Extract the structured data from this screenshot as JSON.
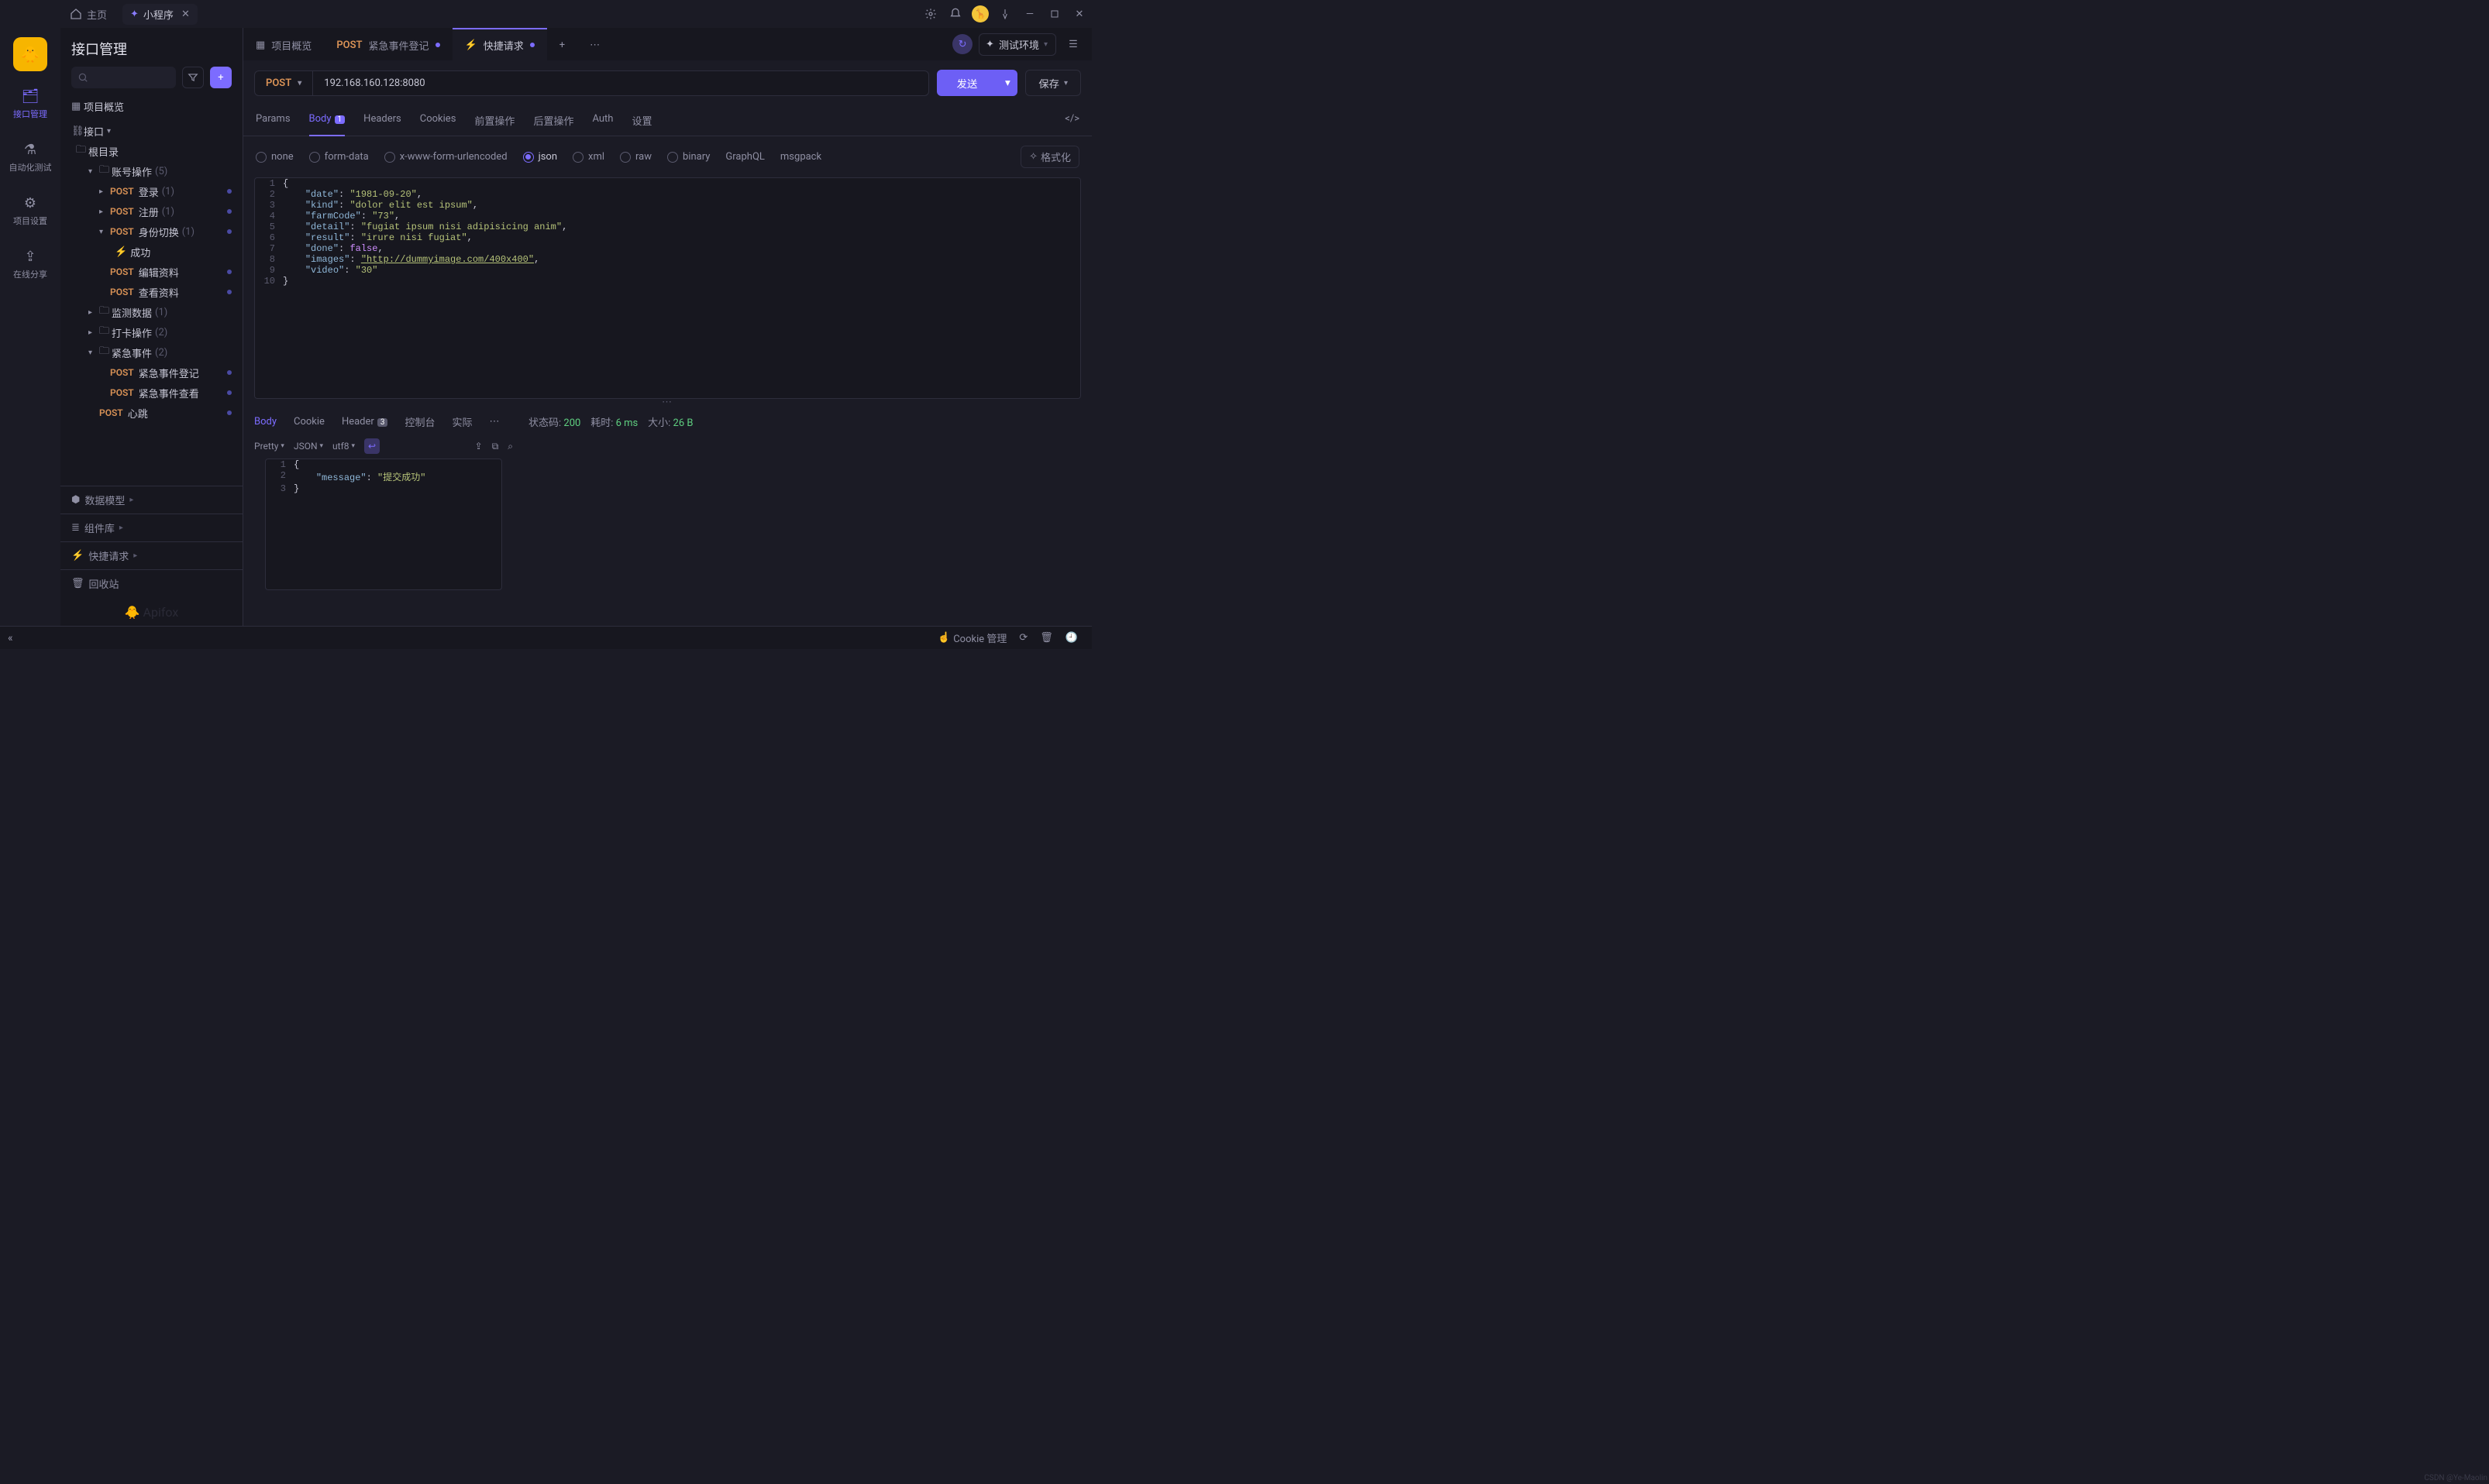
{
  "title_bar": {
    "home": "主页",
    "app_tab": "小程序"
  },
  "nav_rail": {
    "items": [
      "接口管理",
      "自动化测试",
      "项目设置",
      "在线分享"
    ]
  },
  "sidebar": {
    "title": "接口管理",
    "project_overview": "项目概览",
    "interface_root": "接口",
    "root_dir": "根目录",
    "tree": {
      "account": {
        "label": "账号操作",
        "count": "(5)"
      },
      "login": {
        "label": "登录",
        "count": "(1)",
        "method": "POST"
      },
      "register": {
        "label": "注册",
        "count": "(1)",
        "method": "POST"
      },
      "switch": {
        "label": "身份切换",
        "count": "(1)",
        "method": "POST"
      },
      "switch_case": {
        "label": "成功"
      },
      "edit_profile": {
        "label": "编辑资料",
        "method": "POST"
      },
      "view_profile": {
        "label": "查看资料",
        "method": "POST"
      },
      "monitor": {
        "label": "监测数据",
        "count": "(1)"
      },
      "clock": {
        "label": "打卡操作",
        "count": "(2)"
      },
      "emergency": {
        "label": "紧急事件",
        "count": "(2)"
      },
      "emergency_register": {
        "label": "紧急事件登记",
        "method": "POST"
      },
      "emergency_view": {
        "label": "紧急事件查看",
        "method": "POST"
      },
      "heartbeat": {
        "label": "心跳",
        "method": "POST"
      }
    },
    "sections": {
      "data_model": "数据模型",
      "components": "组件库",
      "quick": "快捷请求",
      "trash": "回收站"
    },
    "brand": "Apifox"
  },
  "tabs": {
    "overview": {
      "label": "项目概览"
    },
    "register": {
      "method": "POST",
      "label": "紧急事件登记"
    },
    "quick": {
      "label": "快捷请求"
    }
  },
  "topbar": {
    "env": "测试环境"
  },
  "request": {
    "method": "POST",
    "url": "192.168.160.128:8080",
    "send": "发送",
    "save": "保存",
    "tabs": {
      "params": "Params",
      "body": "Body",
      "body_badge": "1",
      "headers": "Headers",
      "cookies": "Cookies",
      "pre": "前置操作",
      "post": "后置操作",
      "auth": "Auth",
      "settings": "设置"
    },
    "body_types": {
      "none": "none",
      "form": "form-data",
      "url": "x-www-form-urlencoded",
      "json": "json",
      "xml": "xml",
      "raw": "raw",
      "binary": "binary",
      "graphql": "GraphQL",
      "msgpack": "msgpack"
    },
    "format_btn": "格式化",
    "json_body": {
      "date": "1981-09-20",
      "kind": "dolor elit est ipsum",
      "farmCode": "73",
      "detail": "fugiat ipsum nisi adipisicing anim",
      "result": "irure nisi fugiat",
      "done": false,
      "images": "http://dummyimage.com/400x400",
      "video": "30"
    }
  },
  "response": {
    "tabs": {
      "body": "Body",
      "cookie": "Cookie",
      "header": "Header",
      "header_badge": "3",
      "console": "控制台",
      "actual": "实际"
    },
    "toolbar": {
      "pretty": "Pretty",
      "json": "JSON",
      "utf8": "utf8"
    },
    "stats": {
      "code_label": "状态码:",
      "code": "200",
      "time_label": "耗时:",
      "time": "6 ms",
      "size_label": "大小:",
      "size": "26 B"
    },
    "body": {
      "message": "提交成功"
    }
  },
  "footer": {
    "cookie": "Cookie 管理"
  }
}
